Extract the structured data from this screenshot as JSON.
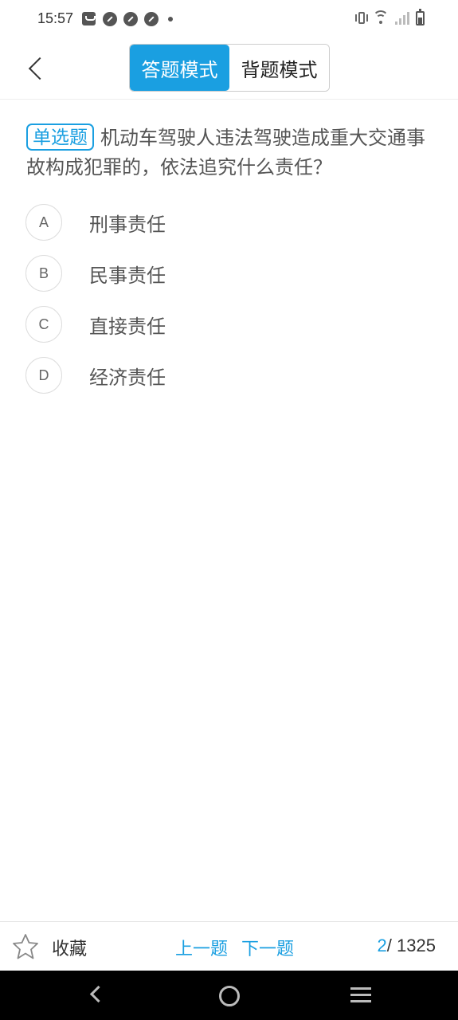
{
  "status_bar": {
    "time": "15:57"
  },
  "header": {
    "back_icon": "chevron-left-icon",
    "modes": [
      {
        "label": "答题模式",
        "active": true
      },
      {
        "label": "背题模式",
        "active": false
      }
    ]
  },
  "question": {
    "type_tag": "单选题",
    "text": "机动车驾驶人违法驾驶造成重大交通事故构成犯罪的，依法追究什么责任？",
    "options": [
      {
        "letter": "A",
        "text": "刑事责任"
      },
      {
        "letter": "B",
        "text": "民事责任"
      },
      {
        "letter": "C",
        "text": "直接责任"
      },
      {
        "letter": "D",
        "text": "经济责任"
      }
    ]
  },
  "toolbar": {
    "favorite_label": "收藏",
    "prev_label": "上一题",
    "next_label": "下一题",
    "current": "2",
    "separator": "/",
    "total": "1325"
  },
  "colors": {
    "accent": "#1a9fe1"
  }
}
